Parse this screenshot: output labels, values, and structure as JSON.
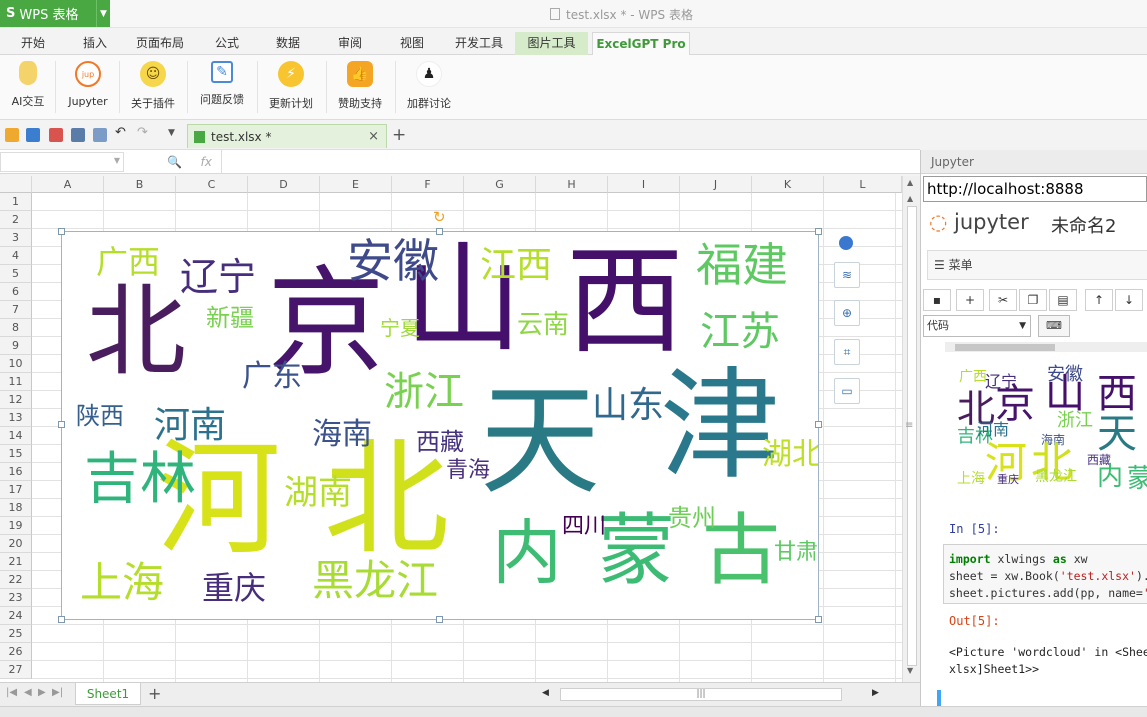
{
  "app": {
    "button_label": "WPS 表格",
    "window_title": "test.xlsx * - WPS 表格"
  },
  "ribbon_tabs": [
    "开始",
    "插入",
    "页面布局",
    "公式",
    "数据",
    "审阅",
    "视图",
    "开发工具",
    "图片工具",
    "ExcelGPT Pro"
  ],
  "ribbon_buttons": [
    "AI交互",
    "Jupyter",
    "关于插件",
    "问题反馈",
    "更新计划",
    "赞助支持",
    "加群讨论"
  ],
  "doc_tab": {
    "label": "test.xlsx *",
    "close": "×",
    "new_tab": "+"
  },
  "formula_bar": {
    "fx": "fx"
  },
  "columns": [
    "A",
    "B",
    "C",
    "D",
    "E",
    "F",
    "G",
    "H",
    "I",
    "J",
    "K",
    "L"
  ],
  "rows": [
    "1",
    "2",
    "3",
    "4",
    "5",
    "6",
    "7",
    "8",
    "9",
    "10",
    "11",
    "12",
    "13",
    "14",
    "15",
    "16",
    "17",
    "18",
    "19",
    "20",
    "21",
    "22",
    "23",
    "24",
    "25",
    "26",
    "27"
  ],
  "wordcloud": {
    "words": [
      {
        "text": "北",
        "color": "#4a1d5e"
      },
      {
        "text": "京",
        "color": "#46146b"
      },
      {
        "text": "山",
        "color": "#450f6c"
      },
      {
        "text": "西",
        "color": "#44106a"
      },
      {
        "text": "天",
        "color": "#2a7a86"
      },
      {
        "text": "津",
        "color": "#2a788b"
      },
      {
        "text": "河",
        "color": "#d8e219"
      },
      {
        "text": "北",
        "color": "#d0e11c"
      },
      {
        "text": "内",
        "color": "#3fbc73"
      },
      {
        "text": "蒙",
        "color": "#3cbb75"
      },
      {
        "text": "古",
        "color": "#4ac16d"
      },
      {
        "text": "广西",
        "color": "#b5de2b"
      },
      {
        "text": "辽宁",
        "color": "#472e7c"
      },
      {
        "text": "安徽",
        "color": "#3e4a89"
      },
      {
        "text": "江西",
        "color": "#b5de2b"
      },
      {
        "text": "福建",
        "color": "#5ec962"
      },
      {
        "text": "江苏",
        "color": "#5ec962"
      },
      {
        "text": "新疆",
        "color": "#7ad151"
      },
      {
        "text": "宁夏",
        "color": "#a0da39"
      },
      {
        "text": "广东",
        "color": "#3b528b"
      },
      {
        "text": "云南",
        "color": "#8fd744"
      },
      {
        "text": "浙江",
        "color": "#7ad151"
      },
      {
        "text": "陕西",
        "color": "#355f8d"
      },
      {
        "text": "河南",
        "color": "#2c728e"
      },
      {
        "text": "海南",
        "color": "#3b528b"
      },
      {
        "text": "西藏",
        "color": "#46337f"
      },
      {
        "text": "山东",
        "color": "#31688e"
      },
      {
        "text": "青海",
        "color": "#4a2f7c"
      },
      {
        "text": "湖北",
        "color": "#bddf26"
      },
      {
        "text": "吉林",
        "color": "#2fb47c"
      },
      {
        "text": "湖南",
        "color": "#b5de2b"
      },
      {
        "text": "四川",
        "color": "#440154"
      },
      {
        "text": "贵州",
        "color": "#6ece58"
      },
      {
        "text": "甘肃",
        "color": "#5ec962"
      },
      {
        "text": "上海",
        "color": "#b5de2b"
      },
      {
        "text": "重庆",
        "color": "#472d7b"
      },
      {
        "text": "黑龙江",
        "color": "#a8db34"
      }
    ]
  },
  "sheet": {
    "tab_label": "Sheet1",
    "add": "+",
    "scroll_grip": "|||"
  },
  "jupyter": {
    "panel_title": "Jupyter",
    "url": "http://localhost:8888",
    "logo_text": "jupyter",
    "notebook_name": "未命名2",
    "menu_label": "菜单",
    "cell_type": "代码",
    "in_prompt": "In  [5]:",
    "code_line1": "xlwings",
    "code_line2_a": "sheet = xw.Book(",
    "code_line2_b": "'test.xlsx'",
    "code_line2_c": ").",
    "code_line3_a": "sheet.pictures.add(pp, name=",
    "code_kw_import": "import",
    "code_kw_as": "as",
    "code_alias": "xw",
    "out_prompt": "Out[5]:",
    "result_line1": "<Picture 'wordcloud' in <Shee",
    "result_line2": "xlsx]Sheet1>>"
  }
}
